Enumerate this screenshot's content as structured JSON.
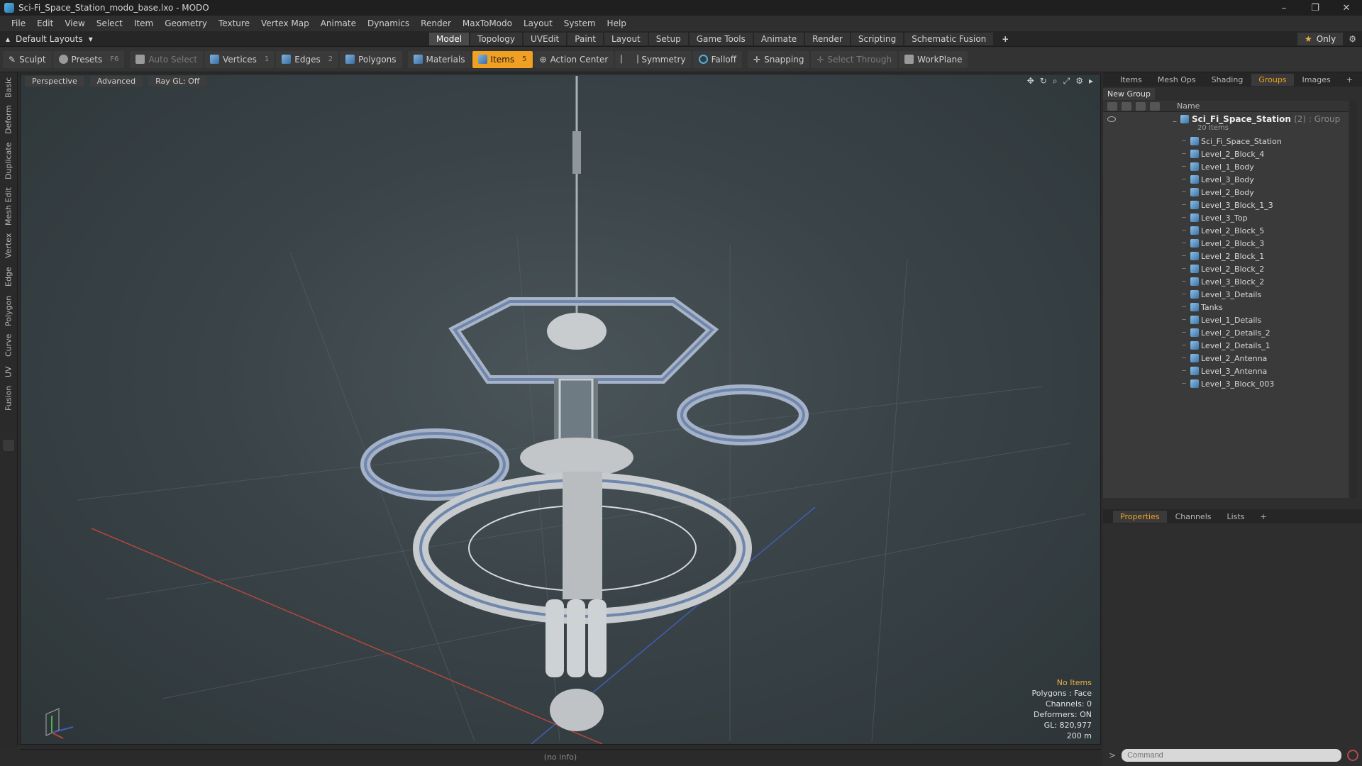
{
  "window": {
    "title": "Sci-Fi_Space_Station_modo_base.lxo - MODO",
    "controls": [
      "–",
      "❐",
      "✕"
    ]
  },
  "menu": [
    "File",
    "Edit",
    "View",
    "Select",
    "Item",
    "Geometry",
    "Texture",
    "Vertex Map",
    "Animate",
    "Dynamics",
    "Render",
    "MaxToModo",
    "Layout",
    "System",
    "Help"
  ],
  "layout": {
    "dropdown": "Default Layouts",
    "tabs": [
      {
        "label": "Model",
        "active": true
      },
      {
        "label": "Topology"
      },
      {
        "label": "UVEdit"
      },
      {
        "label": "Paint"
      },
      {
        "label": "Layout"
      },
      {
        "label": "Setup"
      },
      {
        "label": "Game Tools"
      },
      {
        "label": "Animate"
      },
      {
        "label": "Render"
      },
      {
        "label": "Scripting"
      },
      {
        "label": "Schematic Fusion"
      }
    ],
    "add_tab": "+",
    "only_label": "Only"
  },
  "toolbar": {
    "sculpt": "Sculpt",
    "presets": "Presets",
    "presets_key": "F6",
    "auto_select": "Auto Select",
    "vertices": "Vertices",
    "vertices_key": "1",
    "edges": "Edges",
    "edges_key": "2",
    "polygons": "Polygons",
    "materials": "Materials",
    "items": "Items",
    "items_key": "5",
    "action_center": "Action Center",
    "symmetry": "Symmetry",
    "falloff": "Falloff",
    "snapping": "Snapping",
    "select_through": "Select Through",
    "workplane": "WorkPlane"
  },
  "left_tabs": [
    "Basic",
    "Deform",
    "Duplicate",
    "Mesh Edit",
    "Vertex",
    "Edge",
    "Polygon",
    "Curve",
    "UV",
    "Fusion"
  ],
  "viewport": {
    "view": "Perspective",
    "shading": "Advanced",
    "raygl": "Ray GL: Off",
    "stats": {
      "selection": "No Items",
      "polygons": "Polygons : Face",
      "channels": "Channels: 0",
      "deformers": "Deformers: ON",
      "gl": "GL: 820,977",
      "scale": "200 m"
    }
  },
  "info": "(no info)",
  "panel": {
    "tabs": [
      {
        "label": "Items"
      },
      {
        "label": "Mesh Ops"
      },
      {
        "label": "Shading"
      },
      {
        "label": "Groups",
        "active": true
      },
      {
        "label": "Images"
      },
      {
        "label": "+"
      }
    ],
    "new_group": "New Group",
    "name_col": "Name",
    "group": {
      "name": "Sci_Fi_Space_Station",
      "suffix": "(2) : Group",
      "count": "20 Items"
    },
    "items": [
      "Sci_Fi_Space_Station",
      "Level_2_Block_4",
      "Level_1_Body",
      "Level_3_Body",
      "Level_2_Body",
      "Level_3_Block_1_3",
      "Level_3_Top",
      "Level_2_Block_5",
      "Level_2_Block_3",
      "Level_2_Block_1",
      "Level_2_Block_2",
      "Level_3_Block_2",
      "Level_3_Details",
      "Tanks",
      "Level_1_Details",
      "Level_2_Details_2",
      "Level_2_Details_1",
      "Level_2_Antenna",
      "Level_3_Antenna",
      "Level_3_Block_003"
    ],
    "props_tabs": [
      {
        "label": "Properties",
        "active": true
      },
      {
        "label": "Channels"
      },
      {
        "label": "Lists"
      },
      {
        "label": "+"
      }
    ],
    "command_placeholder": "Command"
  }
}
